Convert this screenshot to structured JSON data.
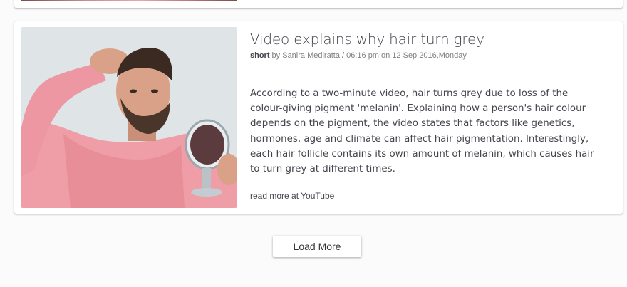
{
  "story": {
    "title": "Video explains why hair turn grey",
    "category": "short",
    "byline": " by Sanira Mediratta / 06:16 pm on 12 Sep 2016,Monday",
    "body": "According to a two-minute video, hair turns grey due to loss of the colour-giving pigment 'melanin'. Explaining how a person's hair colour depends on the pigment, the video states that factors like genetics, hormones, age and climate can affect hair pigmentation. Interestingly, each hair follicle contains its own amount of melanin, which causes hair to turn grey at different times.",
    "read_more_prefix": "read more at ",
    "read_more_source": "YouTube"
  },
  "load_more": {
    "label": "Load More"
  }
}
